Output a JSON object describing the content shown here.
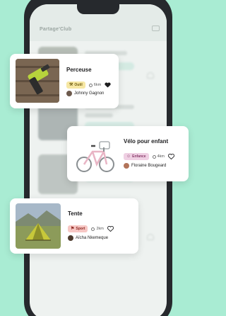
{
  "app": {
    "title": "Partage'Club"
  },
  "items": [
    {
      "title": "Perceuse",
      "category": "Outil",
      "category_color": "#f6e7a3",
      "category_icon": "tools-icon",
      "distance": "6km",
      "favorited": true,
      "owner": "Johnny Gagnon"
    },
    {
      "title": "Vélo pour enfant",
      "category": "Enfance",
      "category_color": "#efd0e3",
      "category_icon": "child-icon",
      "distance": "4km",
      "favorited": false,
      "owner": "Floraine Bougeard"
    },
    {
      "title": "Tente",
      "category": "Sport",
      "category_color": "#f7c7c4",
      "category_icon": "sport-icon",
      "distance": "2km",
      "favorited": false,
      "owner": "Aïcha Nkemeque"
    }
  ],
  "colors": {
    "background": "#a9ecd3",
    "phone": "#26292d"
  }
}
